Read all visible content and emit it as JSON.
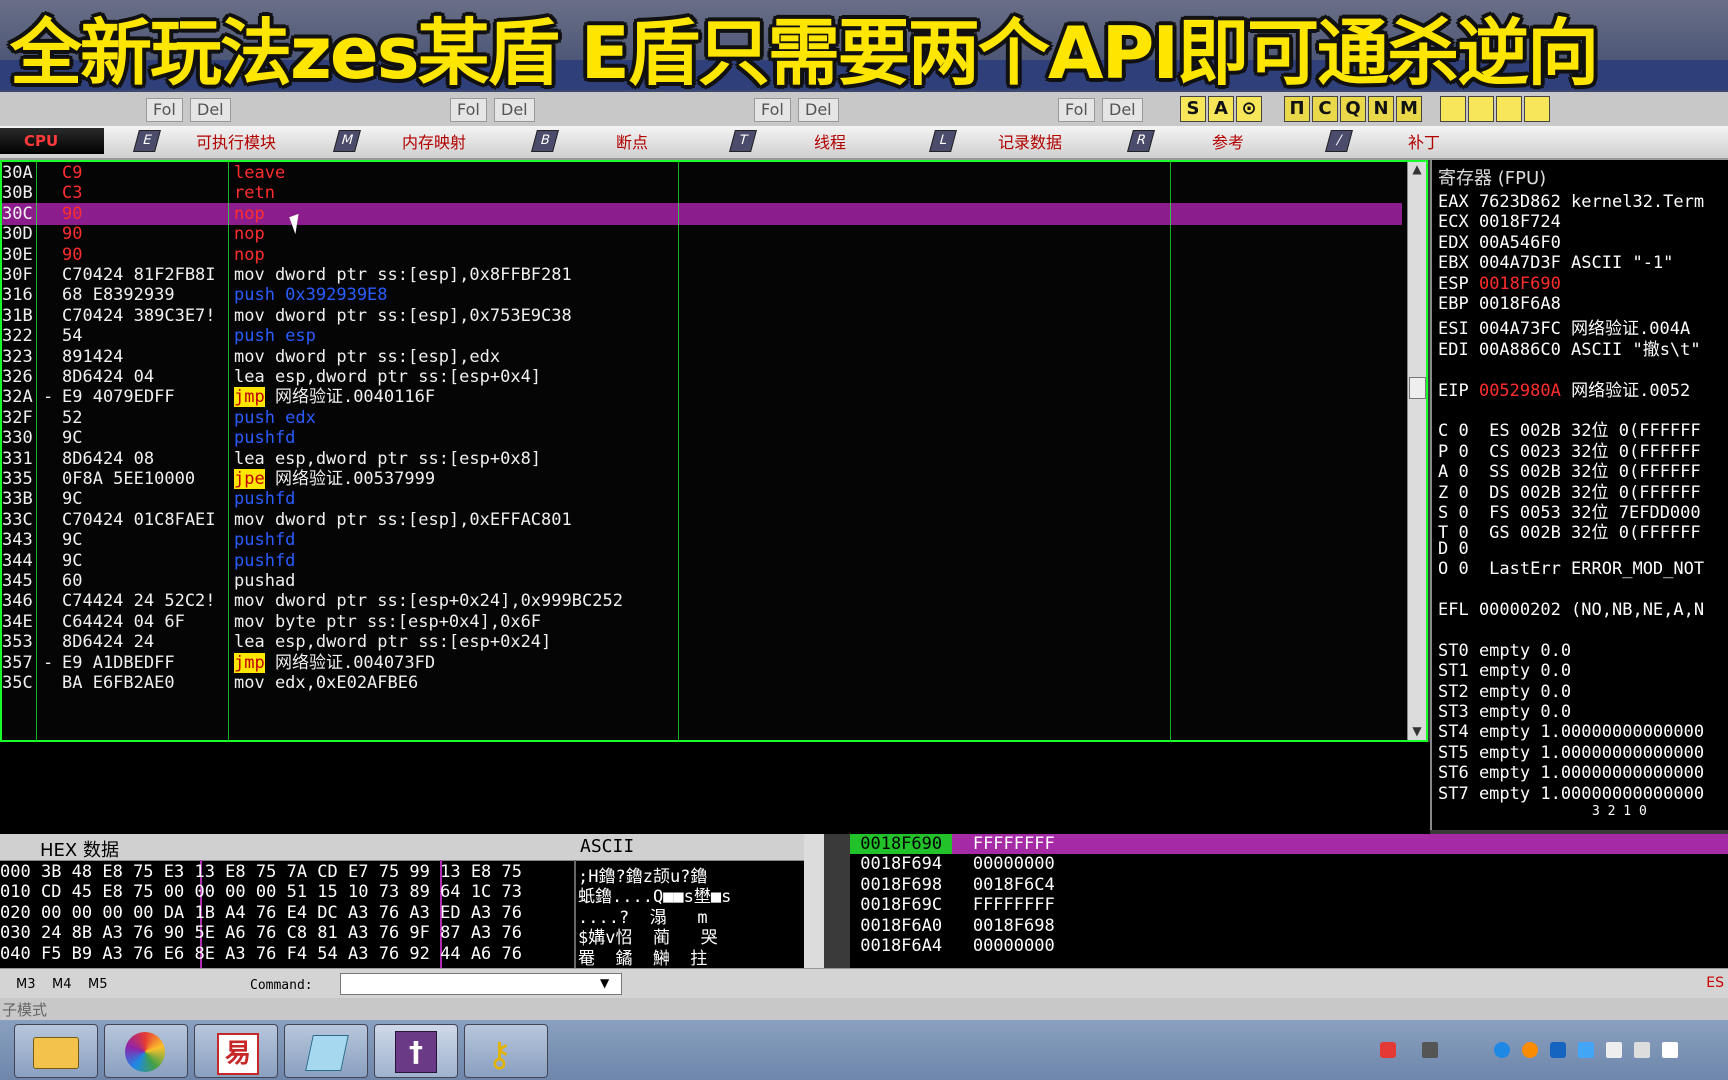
{
  "banner": {
    "title": "全新玩法zes某盾 E盾只需要两个API即可通杀逆向"
  },
  "toolbar": {
    "fol_label": "Fol",
    "del_label": "Del",
    "letters": [
      "S",
      "A",
      "⊙",
      "Π",
      "C",
      "Q",
      "N",
      "M"
    ]
  },
  "tabs": {
    "cpu": "CPU",
    "items": [
      {
        "key": "E",
        "label": "可执行模块"
      },
      {
        "key": "M",
        "label": "内存映射"
      },
      {
        "key": "B",
        "label": "断点"
      },
      {
        "key": "T",
        "label": "线程"
      },
      {
        "key": "L",
        "label": "记录数据"
      },
      {
        "key": "R",
        "label": "参考"
      },
      {
        "key": "/",
        "label": "补丁"
      }
    ]
  },
  "disasm": {
    "rows": [
      {
        "addr": "30A",
        "hex": "C9",
        "asm": "leave",
        "asm_color": "#ff2d2d",
        "hex_color": "#ff2d2d"
      },
      {
        "addr": "30B",
        "hex": "C3",
        "asm": "retn",
        "asm_color": "#ff2d2d",
        "hex_color": "#ff2d2d"
      },
      {
        "addr": "30C",
        "hex": "90",
        "asm": "nop",
        "asm_color": "#ff2d2d",
        "hex_color": "#ff2d2d",
        "selected": true
      },
      {
        "addr": "30D",
        "hex": "90",
        "asm": "nop",
        "asm_color": "#ff2d2d",
        "hex_color": "#ff2d2d"
      },
      {
        "addr": "30E",
        "hex": "90",
        "asm": "nop",
        "asm_color": "#ff2d2d",
        "hex_color": "#ff2d2d"
      },
      {
        "addr": "30F",
        "hex": "C70424 81F2FB8I",
        "asm": "mov dword ptr ss:[esp],0x8FFBF281",
        "asm_color": "#f0f0f0"
      },
      {
        "addr": "316",
        "hex": "68 E8392939",
        "asm": "push 0x392939E8",
        "asm_color": "#2a5cff"
      },
      {
        "addr": "31B",
        "hex": "C70424 389C3E7!",
        "asm": "mov dword ptr ss:[esp],0x753E9C38",
        "asm_color": "#f0f0f0"
      },
      {
        "addr": "322",
        "hex": "54",
        "asm": "push esp",
        "asm_color": "#2a5cff"
      },
      {
        "addr": "323",
        "hex": "891424",
        "asm": "mov dword ptr ss:[esp],edx",
        "asm_color": "#f0f0f0"
      },
      {
        "addr": "326",
        "hex": "8D6424 04",
        "asm": "lea esp,dword ptr ss:[esp+0x4]",
        "asm_color": "#f0f0f0"
      },
      {
        "addr": "32A -",
        "hex": "E9 4079EDFF",
        "asm": "jmp 网络验证.0040116F",
        "asm_color": "#f0f0f0",
        "tag": "jmp"
      },
      {
        "addr": "32F",
        "hex": "52",
        "asm": "push edx",
        "asm_color": "#2a5cff"
      },
      {
        "addr": "330",
        "hex": "9C",
        "asm": "pushfd",
        "asm_color": "#2a5cff"
      },
      {
        "addr": "331",
        "hex": "8D6424 08",
        "asm": "lea esp,dword ptr ss:[esp+0x8]",
        "asm_color": "#f0f0f0"
      },
      {
        "addr": "335",
        "hex": "0F8A 5EE10000",
        "asm": "jpe 网络验证.00537999",
        "asm_color": "#f0f0f0",
        "tag": "jpe"
      },
      {
        "addr": "33B",
        "hex": "9C",
        "asm": "pushfd",
        "asm_color": "#2a5cff"
      },
      {
        "addr": "33C",
        "hex": "C70424 01C8FAEI",
        "asm": "mov dword ptr ss:[esp],0xEFFAC801",
        "asm_color": "#f0f0f0"
      },
      {
        "addr": "343",
        "hex": "9C",
        "asm": "pushfd",
        "asm_color": "#2a5cff"
      },
      {
        "addr": "344",
        "hex": "9C",
        "asm": "pushfd",
        "asm_color": "#2a5cff"
      },
      {
        "addr": "345",
        "hex": "60",
        "asm": "pushad",
        "asm_color": "#f0f0f0"
      },
      {
        "addr": "346",
        "hex": "C74424 24 52C2!",
        "asm": "mov dword ptr ss:[esp+0x24],0x999BC252",
        "asm_color": "#f0f0f0"
      },
      {
        "addr": "34E",
        "hex": "C64424 04 6F",
        "asm": "mov byte ptr ss:[esp+0x4],0x6F",
        "asm_color": "#f0f0f0"
      },
      {
        "addr": "353",
        "hex": "8D6424 24",
        "asm": "lea esp,dword ptr ss:[esp+0x24]",
        "asm_color": "#f0f0f0"
      },
      {
        "addr": "357 -",
        "hex": "E9 A1DBEDFF",
        "asm": "jmp 网络验证.004073FD",
        "asm_color": "#f0f0f0",
        "tag": "jmp"
      },
      {
        "addr": "35C",
        "hex": "BA E6FB2AE0",
        "asm": "mov edx,0xE02AFBE6",
        "asm_color": "#f0f0f0"
      }
    ]
  },
  "registers": {
    "header": "寄存器 (FPU)",
    "lines": [
      {
        "t": "EAX 7623D862 kernel32.Term",
        "c": "#fff"
      },
      {
        "t": "ECX 0018F724",
        "c": "#fff"
      },
      {
        "t": "EDX 00A546F0",
        "c": "#fff"
      },
      {
        "t": "EBX 004A7D3F ASCII \"-1\"",
        "c": "#fff"
      },
      {
        "t": "ESP 0018F690",
        "c": "#fff",
        "v": "0018F690",
        "vc": "#ff2d2d"
      },
      {
        "t": "EBP 0018F6A8",
        "c": "#fff"
      },
      {
        "t": "ESI 004A73FC 网络验证.004A",
        "c": "#fff"
      },
      {
        "t": "EDI 00A886C0 ASCII \"撤s\\t\"",
        "c": "#fff"
      },
      {
        "t": "",
        "c": "#fff"
      },
      {
        "t": "EIP 0052980A 网络验证.0052",
        "c": "#fff",
        "v": "0052980A",
        "vc": "#ff2d2d"
      },
      {
        "t": "",
        "c": "#fff"
      },
      {
        "t": "C 0  ES 002B 32位 0(FFFFFF",
        "c": "#fff"
      },
      {
        "t": "P 0  CS 0023 32位 0(FFFFFF",
        "c": "#fff"
      },
      {
        "t": "A 0  SS 002B 32位 0(FFFFFF",
        "c": "#fff"
      },
      {
        "t": "Z 0  DS 002B 32位 0(FFFFFF",
        "c": "#fff"
      },
      {
        "t": "S 0  FS 0053 32位 7EFDD000",
        "c": "#fff"
      },
      {
        "t": "T 0  GS 002B 32位 0(FFFFFF",
        "c": "#fff"
      },
      {
        "t": "D 0",
        "c": "#fff"
      },
      {
        "t": "O 0  LastErr ERROR_MOD_NOT",
        "c": "#fff"
      },
      {
        "t": "",
        "c": "#fff"
      },
      {
        "t": "EFL 00000202 (NO,NB,NE,A,N",
        "c": "#fff"
      },
      {
        "t": "",
        "c": "#fff"
      },
      {
        "t": "ST0 empty 0.0",
        "c": "#fff"
      },
      {
        "t": "ST1 empty 0.0",
        "c": "#fff"
      },
      {
        "t": "ST2 empty 0.0",
        "c": "#fff"
      },
      {
        "t": "ST3 empty 0.0",
        "c": "#fff"
      },
      {
        "t": "ST4 empty 1.00000000000000",
        "c": "#fff"
      },
      {
        "t": "ST5 empty 1.00000000000000",
        "c": "#fff"
      },
      {
        "t": "ST6 empty 1.00000000000000",
        "c": "#fff"
      },
      {
        "t": "ST7 empty 1.00000000000000",
        "c": "#fff"
      }
    ],
    "footer": "3 2 1 0"
  },
  "hex": {
    "hdr_hex": "HEX 数据",
    "hdr_ascii": "ASCII",
    "rows": [
      {
        "addr": "000",
        "bytes": "3B 48 E8 75 E3 13 E8 75 7A CD E7 75 99 13 E8 75",
        "ascii": ";H鑥?鑥z颉u?鑥"
      },
      {
        "addr": "010",
        "bytes": "CD 45 E8 75 00 00 00 00 51 15 10 73 89 64 1C 73",
        "ascii": "蚔鑥....Q■■s壄■s"
      },
      {
        "addr": "020",
        "bytes": "00 00 00 00 DA 1B A4 76 E4 DC A3 76 A3 ED A3 76",
        "ascii": "....?  溻   m"
      },
      {
        "addr": "030",
        "bytes": "24 8B A3 76 90 5E A6 76 C8 81 A3 76 9F 87 A3 76",
        "ascii": "$媾v怊  蔺   哭"
      },
      {
        "addr": "040",
        "bytes": "F5 B9 A3 76 E6 8E A3 76 F4 54 A3 76 92 44 A6 76",
        "ascii": "罨  鐍  鰰  拄"
      }
    ]
  },
  "stack": {
    "rows": [
      {
        "addr": "0018F690",
        "val": "FFFFFFFF",
        "hl": true
      },
      {
        "addr": "0018F694",
        "val": "00000000"
      },
      {
        "addr": "0018F698",
        "val": "0018F6C4"
      },
      {
        "addr": "0018F69C",
        "val": "FFFFFFFF"
      },
      {
        "addr": "0018F6A0",
        "val": "0018F698"
      },
      {
        "addr": "0018F6A4",
        "val": "00000000"
      }
    ]
  },
  "cmdbar": {
    "m3": "M3",
    "m4": "M4",
    "m5": "M5",
    "command_label": "Command:",
    "right_text": "ES"
  },
  "statusbar": {
    "text": "子模式"
  }
}
